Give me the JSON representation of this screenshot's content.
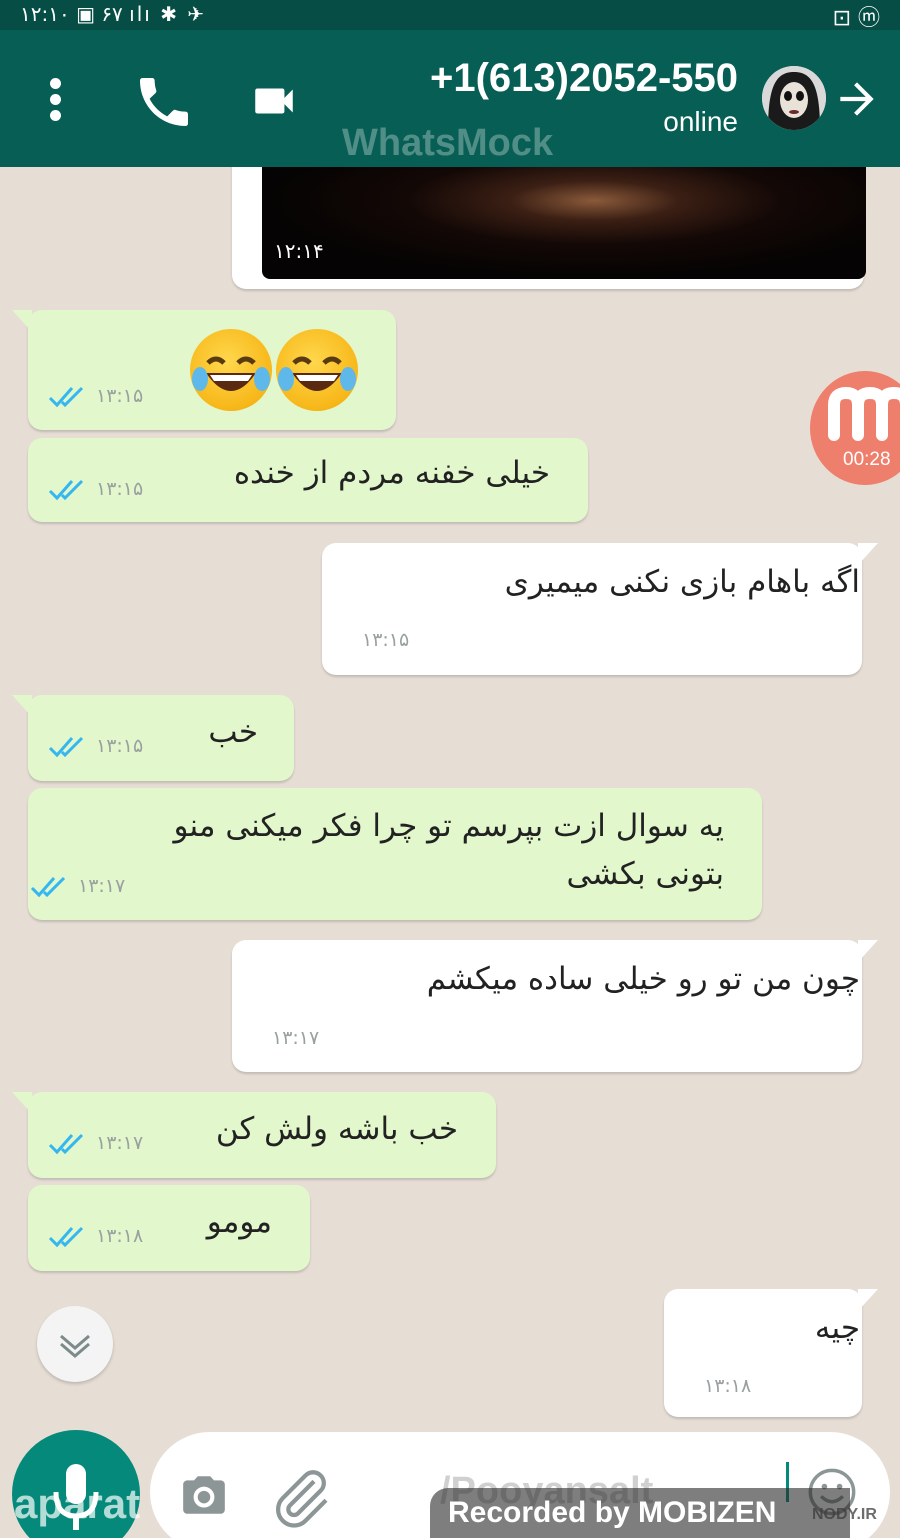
{
  "status_bar": {
    "left_text": "۱۲:۱۰ ▣ ۶۷ ılı ✱ ✈",
    "right_text": "⊡ ⓜ"
  },
  "header": {
    "contact_name": "+1(613)2052-550",
    "contact_status": "online",
    "app_watermark": "WhatsMock",
    "icons": [
      "more-vert-icon",
      "phone-icon",
      "video-call-icon",
      "avatar",
      "arrow-right-icon"
    ]
  },
  "recorder_badge": {
    "time": "00:28"
  },
  "messages": [
    {
      "id": "m0",
      "direction": "in",
      "type": "video",
      "time": "۱۲:۱۴"
    },
    {
      "id": "m1",
      "direction": "out",
      "type": "emoji",
      "text": "😂😂",
      "time": "۱۳:۱۵",
      "status": "read"
    },
    {
      "id": "m2",
      "direction": "out",
      "text": "خیلی خفنه مردم از خنده",
      "time": "۱۳:۱۵",
      "status": "read"
    },
    {
      "id": "m3",
      "direction": "in",
      "text": "اگه باهام بازی نکنی میمیری",
      "time": "۱۳:۱۵"
    },
    {
      "id": "m4",
      "direction": "out",
      "text": "خب",
      "time": "۱۳:۱۵",
      "status": "read"
    },
    {
      "id": "m5",
      "direction": "out",
      "line1": "یه سوال ازت بپرسم تو چرا فکر میکنی منو",
      "line2": "بتونی بکشی",
      "time": "۱۳:۱۷",
      "status": "read"
    },
    {
      "id": "m6",
      "direction": "in",
      "text": "چون من تو رو خیلی ساده میکشم",
      "time": "۱۳:۱۷"
    },
    {
      "id": "m7",
      "direction": "out",
      "text": "خب باشه ولش کن",
      "time": "۱۳:۱۷",
      "status": "read"
    },
    {
      "id": "m8",
      "direction": "out",
      "text": "مومو",
      "time": "۱۳:۱۸",
      "status": "read"
    },
    {
      "id": "m9",
      "direction": "in",
      "text": "چیه",
      "time": "۱۳:۱۸"
    }
  ],
  "input": {
    "placeholder": ""
  },
  "watermarks": {
    "aparat": "aparat",
    "pooyan": "/Pooyansalt",
    "recorded": "Recorded by MOBIZEN",
    "nody": "NODY.IR"
  },
  "colors": {
    "header": "#075e54",
    "status_bar": "#064e45",
    "outgoing_bubble": "#e2f7cb",
    "incoming_bubble": "#ffffff",
    "read_ticks": "#34b7f1",
    "fab": "#04897b",
    "chat_bg": "#e6ded5"
  }
}
